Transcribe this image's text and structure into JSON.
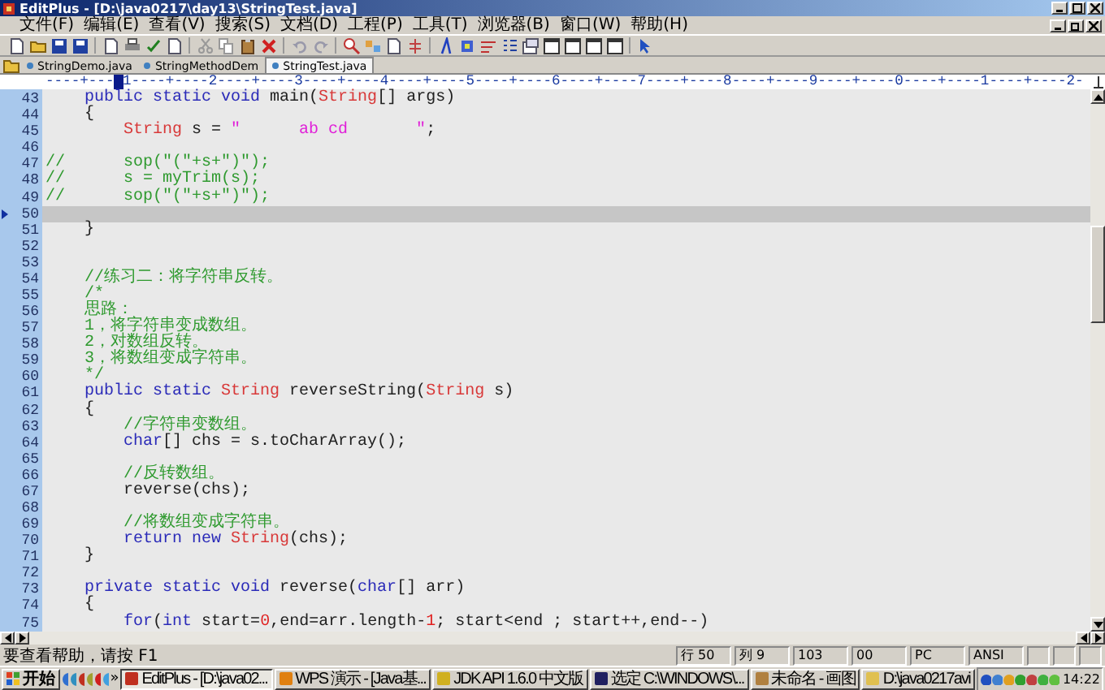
{
  "window": {
    "title": "EditPlus - [D:\\java0217\\day13\\StringTest.java]"
  },
  "menu": [
    "文件(F)",
    "编辑(E)",
    "查看(V)",
    "搜索(S)",
    "文档(D)",
    "工程(P)",
    "工具(T)",
    "浏览器(B)",
    "窗口(W)",
    "帮助(H)"
  ],
  "tabs": [
    {
      "label": "StringDemo.java",
      "selected": false
    },
    {
      "label": "StringMethodDem",
      "selected": false
    },
    {
      "label": "StringTest.java",
      "selected": true
    }
  ],
  "ruler": {
    "before": "----+---",
    "after": "1----+----2----+----3----+----4----+----5----+----6----+----7----+----8----+----9----+----0----+----1----+----2-"
  },
  "code": [
    {
      "number": "43",
      "current": false,
      "tokens": [
        {
          "kind": "kw",
          "text": "    public static void "
        },
        {
          "kind": "plain",
          "text": "main("
        },
        {
          "kind": "type",
          "text": "String"
        },
        {
          "kind": "plain",
          "text": "[] args)"
        }
      ]
    },
    {
      "number": "44",
      "current": false,
      "tokens": [
        {
          "kind": "plain",
          "text": "    {"
        }
      ]
    },
    {
      "number": "45",
      "current": false,
      "tokens": [
        {
          "kind": "type",
          "text": "        String"
        },
        {
          "kind": "plain",
          "text": " s = "
        },
        {
          "kind": "str",
          "text": "\"      ab cd       \""
        },
        {
          "kind": "plain",
          "text": ";"
        }
      ]
    },
    {
      "number": "46",
      "current": false
    },
    {
      "number": "47",
      "current": false,
      "tokens": [
        {
          "kind": "cm",
          "text": "//      sop(\"(\"+s+\")\");"
        }
      ]
    },
    {
      "number": "48",
      "current": false,
      "tokens": [
        {
          "kind": "cm",
          "text": "//      s = myTrim(s);"
        }
      ]
    },
    {
      "number": "49",
      "current": false,
      "tokens": [
        {
          "kind": "cm",
          "text": "//      sop(\"(\"+s+\")\");"
        }
      ]
    },
    {
      "number": "50",
      "current": true
    },
    {
      "number": "51",
      "current": false,
      "tokens": [
        {
          "kind": "plain",
          "text": "    }"
        }
      ]
    },
    {
      "number": "52",
      "current": false
    },
    {
      "number": "53",
      "current": false
    },
    {
      "number": "54",
      "current": false,
      "tokens": [
        {
          "kind": "cm",
          "text": "    //练习二：将字符串反转。"
        }
      ]
    },
    {
      "number": "55",
      "current": false,
      "tokens": [
        {
          "kind": "cm",
          "text": "    /*"
        }
      ]
    },
    {
      "number": "56",
      "current": false,
      "tokens": [
        {
          "kind": "cm",
          "text": "    思路："
        }
      ]
    },
    {
      "number": "57",
      "current": false,
      "tokens": [
        {
          "kind": "cm",
          "text": "    1，将字符串变成数组。"
        }
      ]
    },
    {
      "number": "58",
      "current": false,
      "tokens": [
        {
          "kind": "cm",
          "text": "    2，对数组反转。"
        }
      ]
    },
    {
      "number": "59",
      "current": false,
      "tokens": [
        {
          "kind": "cm",
          "text": "    3，将数组变成字符串。"
        }
      ]
    },
    {
      "number": "60",
      "current": false,
      "tokens": [
        {
          "kind": "cm",
          "text": "    */"
        }
      ]
    },
    {
      "number": "61",
      "current": false,
      "tokens": [
        {
          "kind": "kw",
          "text": "    public static "
        },
        {
          "kind": "type",
          "text": "String"
        },
        {
          "kind": "plain",
          "text": " reverseString("
        },
        {
          "kind": "type",
          "text": "String"
        },
        {
          "kind": "plain",
          "text": " s)"
        }
      ]
    },
    {
      "number": "62",
      "current": false,
      "tokens": [
        {
          "kind": "plain",
          "text": "    {"
        }
      ]
    },
    {
      "number": "63",
      "current": false,
      "tokens": [
        {
          "kind": "cm",
          "text": "        //字符串变数组。"
        }
      ]
    },
    {
      "number": "64",
      "current": false,
      "tokens": [
        {
          "kind": "kw",
          "text": "        char"
        },
        {
          "kind": "plain",
          "text": "[] chs = s.toCharArray();"
        }
      ]
    },
    {
      "number": "65",
      "current": false
    },
    {
      "number": "66",
      "current": false,
      "tokens": [
        {
          "kind": "cm",
          "text": "        //反转数组。"
        }
      ]
    },
    {
      "number": "67",
      "current": false,
      "tokens": [
        {
          "kind": "plain",
          "text": "        reverse(chs);"
        }
      ]
    },
    {
      "number": "68",
      "current": false
    },
    {
      "number": "69",
      "current": false,
      "tokens": [
        {
          "kind": "cm",
          "text": "        //将数组变成字符串。"
        }
      ]
    },
    {
      "number": "70",
      "current": false,
      "tokens": [
        {
          "kind": "kw",
          "text": "        return new "
        },
        {
          "kind": "type",
          "text": "String"
        },
        {
          "kind": "plain",
          "text": "(chs);"
        }
      ]
    },
    {
      "number": "71",
      "current": false,
      "tokens": [
        {
          "kind": "plain",
          "text": "    }"
        }
      ]
    },
    {
      "number": "72",
      "current": false
    },
    {
      "number": "73",
      "current": false,
      "tokens": [
        {
          "kind": "kw",
          "text": "    private static void "
        },
        {
          "kind": "plain",
          "text": "reverse("
        },
        {
          "kind": "kw",
          "text": "char"
        },
        {
          "kind": "plain",
          "text": "[] arr)"
        }
      ]
    },
    {
      "number": "74",
      "current": false,
      "tokens": [
        {
          "kind": "plain",
          "text": "    {"
        }
      ]
    },
    {
      "number": "75",
      "current": false,
      "tokens": [
        {
          "kind": "kw",
          "text": "        for"
        },
        {
          "kind": "plain",
          "text": "("
        },
        {
          "kind": "kw",
          "text": "int"
        },
        {
          "kind": "plain",
          "text": " start="
        },
        {
          "kind": "num",
          "text": "0"
        },
        {
          "kind": "plain",
          "text": ",end=arr.length-"
        },
        {
          "kind": "num",
          "text": "1"
        },
        {
          "kind": "plain",
          "text": "; start<end ; start++,end--)"
        }
      ]
    }
  ],
  "status_bar": {
    "message": "要查看帮助，请按 F1",
    "cells": [
      "行 50",
      "列 9",
      "103",
      "00",
      "PC",
      "ANSI"
    ]
  },
  "taskbar": {
    "start": "开始",
    "more": "»",
    "tasks": [
      {
        "label": "EditPlus - [D:\\java02...",
        "selected": true
      },
      {
        "label": "WPS 演示 - [Java基...",
        "selected": false
      },
      {
        "label": "JDK API 1.6.0 中文版",
        "selected": false
      },
      {
        "label": "选定 C:\\WINDOWS\\...",
        "selected": false
      },
      {
        "label": "未命名 - 画图",
        "selected": false
      },
      {
        "label": "D:\\java0217avi",
        "selected": false
      }
    ],
    "clock": "14:22"
  }
}
